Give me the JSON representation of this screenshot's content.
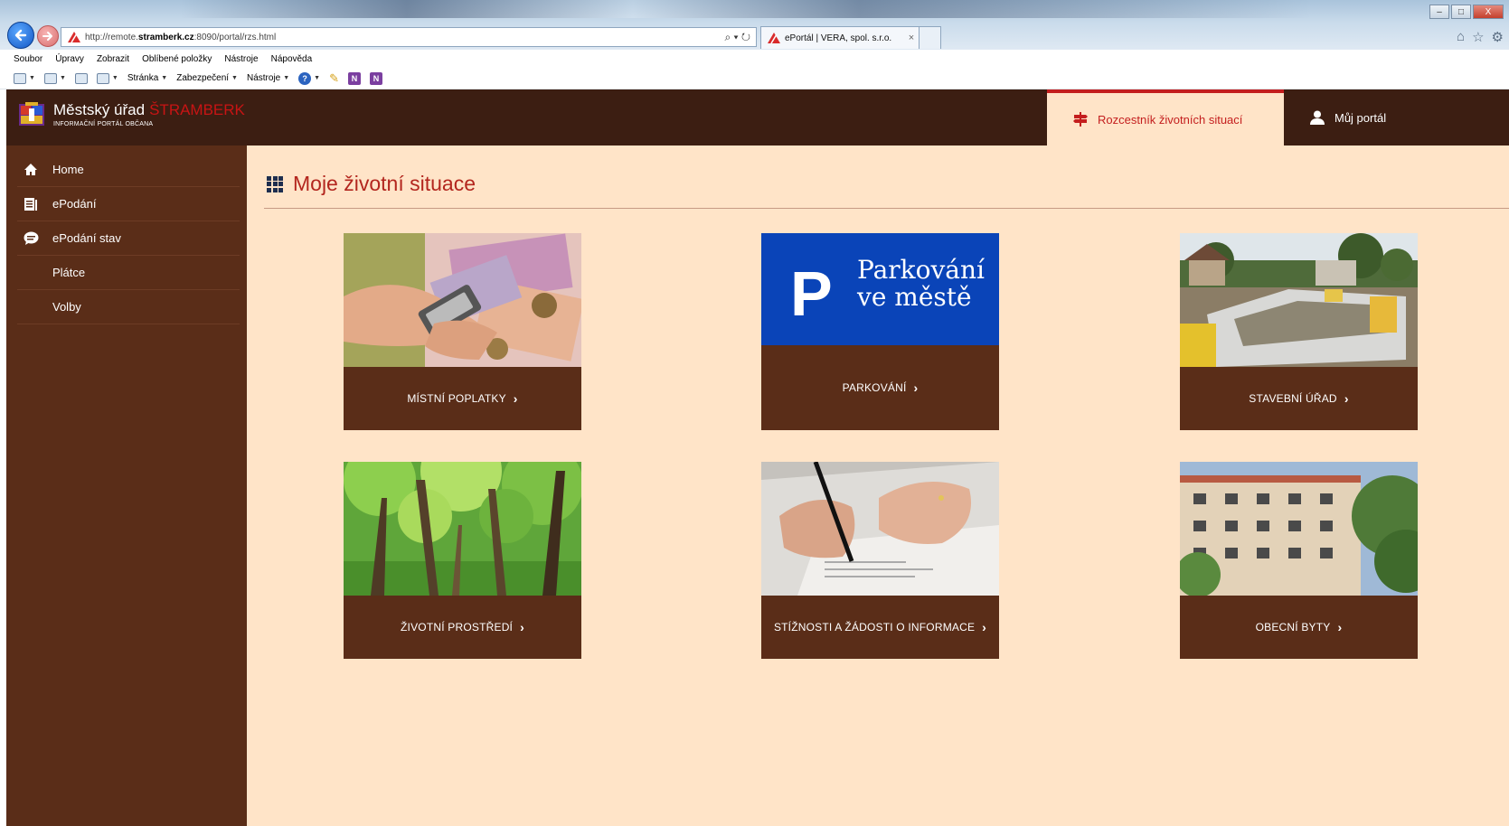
{
  "browser": {
    "url_prefix": "http://remote.",
    "url_host": "stramberk.cz",
    "url_suffix": ":8090/portal/rzs.html",
    "addr_tools": "⌕ ▾ ↻",
    "tab_title": "ePortál | VERA, spol. s.r.o.",
    "tab_close": "×",
    "win_min": "–",
    "win_max": "□",
    "win_close": "X",
    "menu": [
      "Soubor",
      "Úpravy",
      "Zobrazit",
      "Oblíbené položky",
      "Nástroje",
      "Nápověda"
    ],
    "toolbar": {
      "page": "Stránka",
      "security": "Zabezpečení",
      "tools": "Nástroje",
      "help": "?",
      "n1": "N",
      "n2": "N"
    }
  },
  "portal": {
    "brand_title": "Městský úřad",
    "brand_accent": "ŠTRAMBERK",
    "brand_subtitle": "INFORMAČNÍ PORTÁL OBČANA",
    "nav_tabs": [
      {
        "label": "Rozcestník životních situací",
        "icon": "signpost-icon",
        "active": true
      },
      {
        "label": "Můj portál",
        "icon": "user-icon",
        "active": false
      }
    ],
    "sidebar": [
      {
        "label": "Home",
        "icon": "home-icon"
      },
      {
        "label": "ePodání",
        "icon": "document-icon"
      },
      {
        "label": "ePodání stav",
        "icon": "chat-icon"
      },
      {
        "label": "Plátce",
        "icon": ""
      },
      {
        "label": "Volby",
        "icon": ""
      }
    ],
    "page_title": "Moje životní situace",
    "cards": [
      {
        "label": "MÍSTNÍ POPLATKY",
        "image": "money-calculator"
      },
      {
        "label": "PARKOVÁNÍ",
        "image": "parking-sign",
        "image_text_1": "Parkování",
        "image_text_2": "ve městě",
        "image_letter": "P"
      },
      {
        "label": "STAVEBNÍ ÚŘAD",
        "image": "construction-site"
      },
      {
        "label": "ŽIVOTNÍ PROSTŘEDÍ",
        "image": "forest"
      },
      {
        "label": "STÍŽNOSTI A ŽÁDOSTI O INFORMACE",
        "image": "hand-writing"
      },
      {
        "label": "OBECNÍ BYTY",
        "image": "apartment-building"
      }
    ],
    "chevron": "›"
  },
  "colors": {
    "header_bg": "#3c1e12",
    "sidebar_bg": "#5a2d18",
    "content_bg": "#ffe4c8",
    "accent_red": "#c41e1e",
    "title_red": "#b3261e",
    "parking_blue": "#0a44b8"
  }
}
